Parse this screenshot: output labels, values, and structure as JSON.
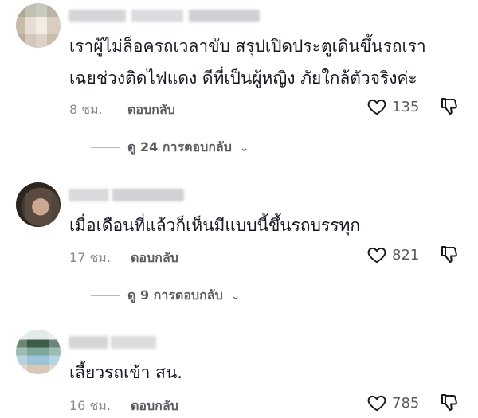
{
  "comments": [
    {
      "text_lines": [
        "เราผู้ไม่ล็อครถเวลาขับ สรุปเปิดประตูเดินขึ้นรถเรา",
        "เฉยช่วงติดไฟแดง ดีที่เป็นผู้หญิง ภัยใกล้ตัวจริงค่ะ"
      ],
      "time": "8 ชม.",
      "reply_label": "ตอบกลับ",
      "likes": "135",
      "view_replies": "ดู 24 การตอบกลับ"
    },
    {
      "text_lines": [
        "เมื่อเดือนที่แล้วก็เห็นมีแบบนี้ขึ้นรถบรรทุก"
      ],
      "time": "17 ชม.",
      "reply_label": "ตอบกลับ",
      "likes": "821",
      "view_replies": "ดู 9 การตอบกลับ"
    },
    {
      "text_lines": [
        "เลี้ยวรถเข้า สน."
      ],
      "time": "16 ชม.",
      "reply_label": "ตอบกลับ",
      "likes": "785"
    }
  ],
  "colors": {
    "text": "#161823",
    "muted": "#8a8b91",
    "secondary": "#5b5c63"
  },
  "icons": {
    "like": "heart-outline-icon",
    "dislike": "thumbs-down-outline-icon",
    "expand": "chevron-down-icon"
  }
}
